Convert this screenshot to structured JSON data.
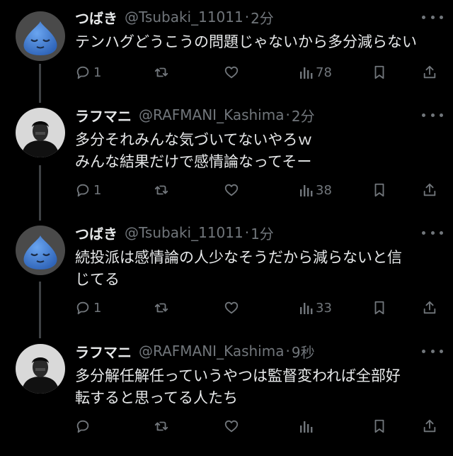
{
  "tweets": [
    {
      "display_name": "つばき",
      "handle": "@Tsubaki_11011",
      "separator": "·",
      "time": "2分",
      "avatar_icon": "slime-icon",
      "lines": [
        "テンハグどうこうの問題じゃないから多分減らない"
      ],
      "replies": "1",
      "retweets": "",
      "likes": "",
      "views": "78"
    },
    {
      "display_name": "ラフマニ",
      "handle": "@RAFMANI_Kashima",
      "separator": "·",
      "time": "2分",
      "avatar_icon": "person-photo-icon",
      "lines": [
        "多分それみんな気づいてないやろｗ",
        "みんな結果だけで感情論なってそー"
      ],
      "replies": "1",
      "retweets": "",
      "likes": "",
      "views": "38"
    },
    {
      "display_name": "つばき",
      "handle": "@Tsubaki_11011",
      "separator": "·",
      "time": "1分",
      "avatar_icon": "slime-icon",
      "lines": [
        "続投派は感情論の人少なそうだから減らないと信",
        "じてる"
      ],
      "replies": "1",
      "retweets": "",
      "likes": "",
      "views": "33"
    },
    {
      "display_name": "ラフマニ",
      "handle": "@RAFMANI_Kashima",
      "separator": "·",
      "time": "9秒",
      "avatar_icon": "person-photo-icon",
      "lines": [
        "多分解任解任っていうやつは監督変われば全部好",
        "転すると思ってる人たち"
      ],
      "replies": "",
      "retweets": "",
      "likes": "",
      "views": ""
    }
  ],
  "colors": {
    "background": "#000000",
    "text": "#e7e9ea",
    "muted": "#71767b",
    "thread_line": "#3e4144",
    "slime_blue": "#3f7fd6"
  }
}
